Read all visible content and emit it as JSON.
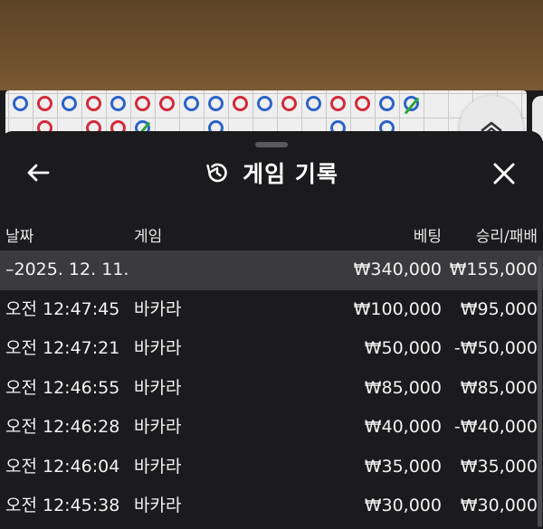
{
  "header": {
    "title": "게임 기록"
  },
  "columns": {
    "date": "날짜",
    "game": "게임",
    "bet": "베팅",
    "result": "승리/패배"
  },
  "summary": {
    "date": "–2025. 12. 11.",
    "bet": "₩340,000",
    "result": "₩155,000"
  },
  "rows": [
    {
      "time": "오전 12:47:45",
      "game": "바카라",
      "bet": "₩100,000",
      "result": "₩95,000"
    },
    {
      "time": "오전 12:47:21",
      "game": "바카라",
      "bet": "₩50,000",
      "result": "-₩50,000"
    },
    {
      "time": "오전 12:46:55",
      "game": "바카라",
      "bet": "₩85,000",
      "result": "₩85,000"
    },
    {
      "time": "오전 12:46:28",
      "game": "바카라",
      "bet": "₩40,000",
      "result": "-₩40,000"
    },
    {
      "time": "오전 12:46:04",
      "game": "바카라",
      "bet": "₩35,000",
      "result": "₩35,000"
    },
    {
      "time": "오전 12:45:38",
      "game": "바카라",
      "bet": "₩30,000",
      "result": "₩30,000"
    }
  ],
  "icons": {
    "back": "arrow-left-icon",
    "history": "history-icon",
    "close": "close-icon",
    "scroll_up": "chevron-up-icon"
  },
  "colors": {
    "player": "#2d63c7",
    "banker": "#d22b3a",
    "tie": "#2aa33a",
    "sheet": "#1b1b1d",
    "summary_row": "#3b3b3d"
  },
  "roadmap": {
    "row1": [
      "B",
      "R",
      "B",
      "R",
      "B",
      "R",
      "R",
      "B",
      "B",
      "R",
      "B",
      "R",
      "B",
      "R",
      "R",
      "B",
      "T"
    ],
    "row2": [
      "",
      "R",
      "",
      "R",
      "R",
      "T",
      "",
      "",
      "B",
      "",
      "",
      "",
      "",
      "B",
      "",
      "B",
      ""
    ]
  }
}
